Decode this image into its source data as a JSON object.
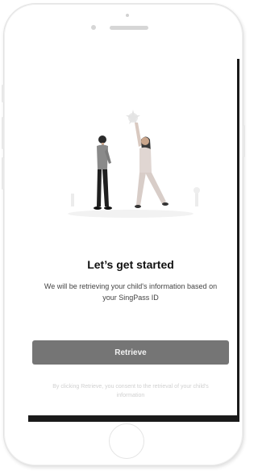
{
  "onboarding": {
    "title": "Let’s get started",
    "subtitle": "We will be retrieving your child's information based on your SingPass ID",
    "retrieve_label": "Retrieve",
    "footnote": "By clicking Retrieve, you consent to the retrieval of your child's information"
  },
  "illustration": {
    "name": "two-people-reaching-illustration"
  },
  "colors": {
    "button_bg": "#757575",
    "button_text": "#f2f2f2",
    "title": "#111111",
    "body_text": "#444444",
    "footnote": "#d0d0d0"
  }
}
